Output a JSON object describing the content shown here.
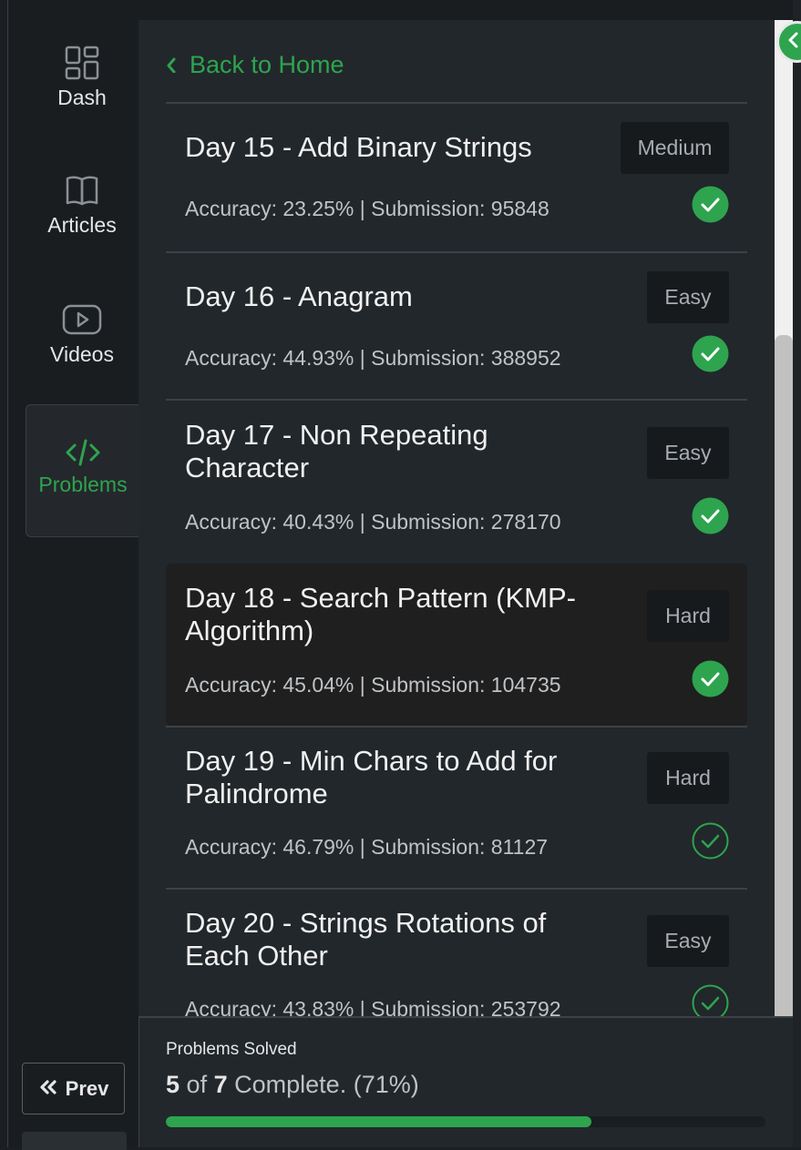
{
  "sidebar": {
    "items": [
      {
        "label": "Dash",
        "icon": "dashboard-icon"
      },
      {
        "label": "Articles",
        "icon": "book-icon"
      },
      {
        "label": "Videos",
        "icon": "video-icon"
      },
      {
        "label": "Problems",
        "icon": "code-icon",
        "active": true
      }
    ],
    "prev_label": "Prev"
  },
  "nav": {
    "back_label": "Back to Home"
  },
  "problems": [
    {
      "title": "Day 15 - Add Binary Strings",
      "meta": "Accuracy: 23.25% | Submission: 95848",
      "difficulty": "Medium",
      "status": "solved"
    },
    {
      "title": "Day 16 - Anagram",
      "meta": "Accuracy: 44.93% | Submission: 388952",
      "difficulty": "Easy",
      "status": "solved"
    },
    {
      "title": "Day 17 - Non Repeating Character",
      "meta": "Accuracy: 40.43% | Submission: 278170",
      "difficulty": "Easy",
      "status": "solved"
    },
    {
      "title": "Day 18 - Search Pattern (KMP-Algorithm)",
      "meta": "Accuracy: 45.04% | Submission: 104735",
      "difficulty": "Hard",
      "status": "solved"
    },
    {
      "title": "Day 19 - Min Chars to Add for Palindrome",
      "meta": "Accuracy: 46.79% | Submission: 81127",
      "difficulty": "Hard",
      "status": "unsolved"
    },
    {
      "title": "Day 20 - Strings Rotations of Each Other",
      "meta": "Accuracy: 43.83% | Submission: 253792",
      "difficulty": "Easy",
      "status": "unsolved"
    }
  ],
  "footer": {
    "label": "Problems Solved",
    "solved": "5",
    "of_text": "of",
    "total": "7",
    "complete_text": "Complete. (71%)",
    "progress": 0.71
  },
  "colors": {
    "accent": "#2ea44f",
    "background": "#22272b",
    "sidebar": "#1a1d20"
  }
}
